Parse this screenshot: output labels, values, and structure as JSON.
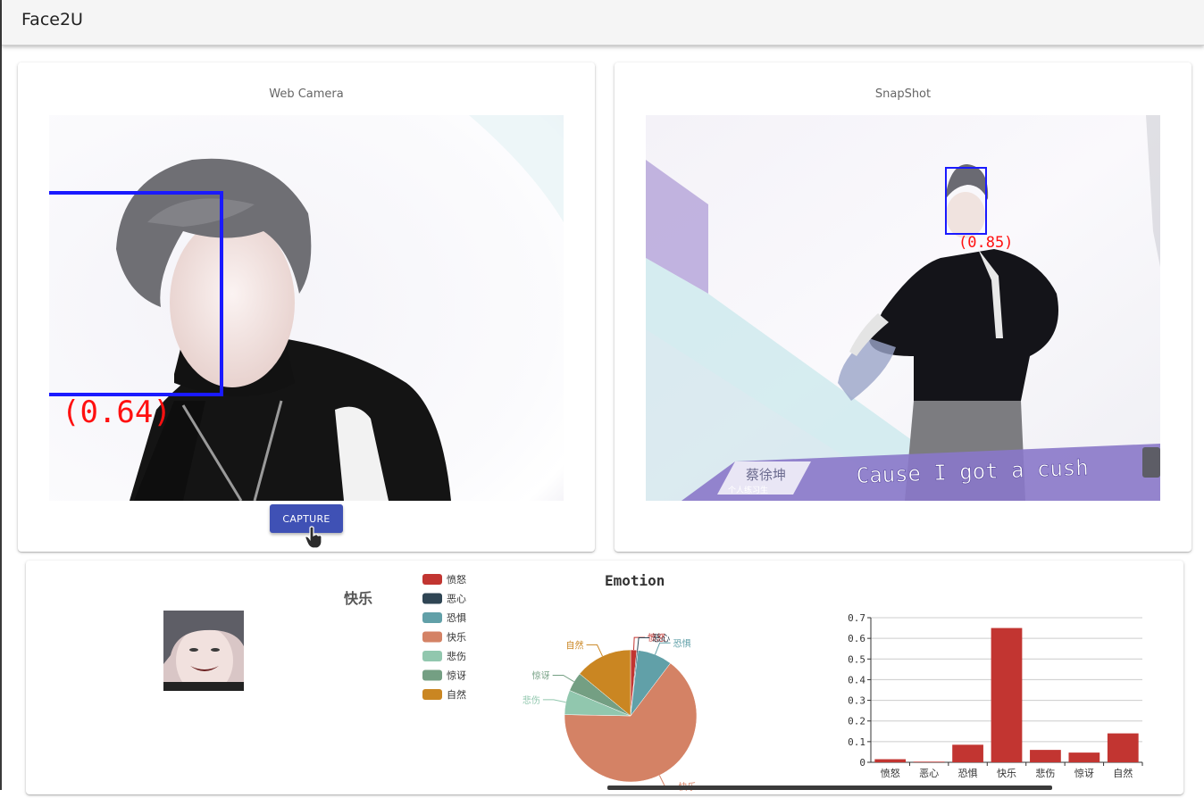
{
  "app": {
    "title": "Face2U"
  },
  "webcam": {
    "title": "Web Camera",
    "score_label": "(0.64)",
    "capture_label": "CAPTURE"
  },
  "snapshot": {
    "title": "SnapShot",
    "score_label": "(0.85)",
    "caption_name": "蔡徐坤",
    "caption_sub": "个人练习生",
    "subtitle": "Cause I got a cush"
  },
  "result": {
    "predicted_emotion": "快乐"
  },
  "colors": {
    "accent": "#3f51b5",
    "bar": "#c23531",
    "face_box": "#1a1aff",
    "score_text": "#ff1010"
  },
  "chart_data": [
    {
      "type": "pie",
      "title": "Emotion",
      "legend_position": "top-left",
      "categories": [
        "愤怒",
        "恶心",
        "恐惧",
        "快乐",
        "悲伤",
        "惊讶",
        "自然"
      ],
      "values": [
        0.015,
        0.003,
        0.085,
        0.65,
        0.06,
        0.047,
        0.14
      ],
      "colors": [
        "#c23531",
        "#2f4554",
        "#61a0a8",
        "#d48265",
        "#91c7ae",
        "#749f83",
        "#ca8622"
      ]
    },
    {
      "type": "bar",
      "categories": [
        "愤怒",
        "恶心",
        "恐惧",
        "快乐",
        "悲伤",
        "惊讶",
        "自然"
      ],
      "values": [
        0.015,
        0.003,
        0.085,
        0.65,
        0.06,
        0.047,
        0.14
      ],
      "ylim": [
        0,
        0.7
      ],
      "yticks": [
        "0",
        "0.1",
        "0.2",
        "0.3",
        "0.4",
        "0.5",
        "0.6",
        "0.7"
      ],
      "grid": true
    }
  ]
}
